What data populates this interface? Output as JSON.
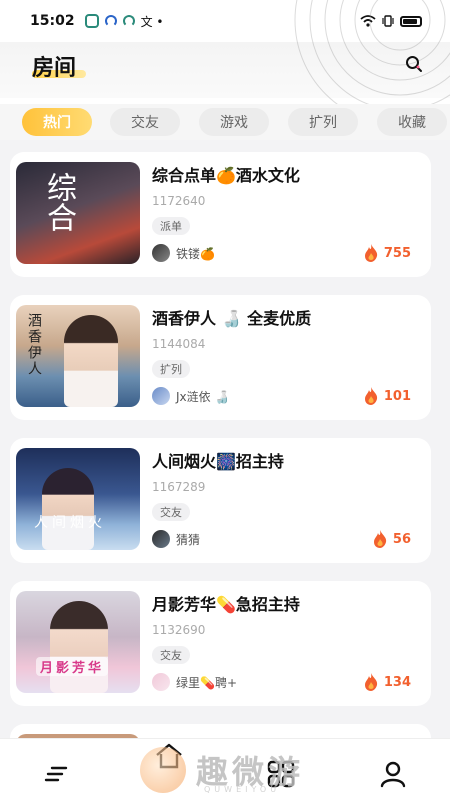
{
  "status_bar": {
    "time": "15:02",
    "extra_icons": "文 •"
  },
  "header": {
    "title": "房间"
  },
  "tabs": [
    {
      "label": "热门",
      "active": true
    },
    {
      "label": "交友",
      "active": false
    },
    {
      "label": "游戏",
      "active": false
    },
    {
      "label": "扩列",
      "active": false
    },
    {
      "label": "收藏",
      "active": false
    }
  ],
  "rooms": [
    {
      "title": "综合点单🍊酒水文化",
      "room_id": "1172640",
      "tag": "派单",
      "host": "铁镂🍊",
      "heat": "755",
      "thumb_text": "综合"
    },
    {
      "title": "酒香伊人 🍶 全麦优质",
      "room_id": "1144084",
      "tag": "扩列",
      "host": "Jx涟依 🍶",
      "heat": "101",
      "thumb_text": "酒香伊人"
    },
    {
      "title": "人间烟火🎆招主持",
      "room_id": "1167289",
      "tag": "交友",
      "host": "猜猜",
      "heat": "56",
      "thumb_text": "人间烟火"
    },
    {
      "title": "月影芳华💊急招主持",
      "room_id": "1132690",
      "tag": "交友",
      "host": "绿里💊聘+",
      "heat": "134",
      "thumb_text": "月影芳华"
    }
  ],
  "watermark": {
    "text": "趣微游",
    "sub": "QUWEIYOU"
  },
  "colors": {
    "accent": "#ffc23a",
    "heat": "#f2602e"
  }
}
